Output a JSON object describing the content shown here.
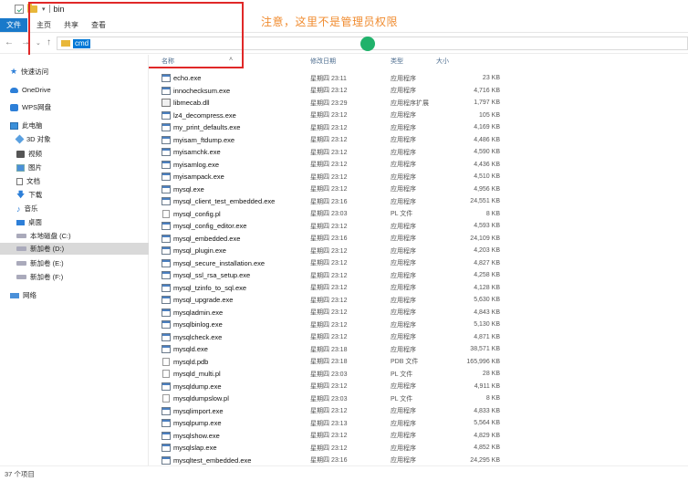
{
  "window": {
    "title": "bin"
  },
  "ribbon": {
    "file": "文件",
    "tabs": [
      "主页",
      "共享",
      "查看"
    ]
  },
  "address": {
    "value": "cmd"
  },
  "annotation": {
    "text": "注意，这里不是管理员权限"
  },
  "columns": {
    "name": "名称",
    "date": "修改日期",
    "type": "类型",
    "size": "大小"
  },
  "sidebar": {
    "items": [
      {
        "label": "快速访问",
        "icon": "star-icon"
      },
      {
        "label": "OneDrive",
        "icon": "cloud-icon"
      },
      {
        "label": "WPS网盘",
        "icon": "wps-cloud-icon"
      },
      {
        "label": "此电脑",
        "icon": "computer-icon"
      },
      {
        "label": "3D 对象",
        "icon": "cube-icon"
      },
      {
        "label": "视频",
        "icon": "video-icon"
      },
      {
        "label": "图片",
        "icon": "picture-icon"
      },
      {
        "label": "文档",
        "icon": "document-icon"
      },
      {
        "label": "下载",
        "icon": "download-arrow-icon"
      },
      {
        "label": "音乐",
        "icon": "music-note-icon"
      },
      {
        "label": "桌面",
        "icon": "desktop-icon"
      },
      {
        "label": "本地磁盘 (C:)",
        "icon": "drive-icon"
      },
      {
        "label": "新加卷 (D:)",
        "icon": "drive-icon",
        "selected": true
      },
      {
        "label": "新加卷 (E:)",
        "icon": "drive-icon"
      },
      {
        "label": "新加卷 (F:)",
        "icon": "drive-icon"
      },
      {
        "label": "网络",
        "icon": "network-icon"
      }
    ]
  },
  "files": [
    {
      "name": "echo.exe",
      "date": "星期四 23:11",
      "type": "应用程序",
      "size": "23 KB",
      "kind": "exe"
    },
    {
      "name": "innochecksum.exe",
      "date": "星期四 23:12",
      "type": "应用程序",
      "size": "4,716 KB",
      "kind": "exe"
    },
    {
      "name": "libmecab.dll",
      "date": "星期四 23:29",
      "type": "应用程序扩展",
      "size": "1,797 KB",
      "kind": "dll"
    },
    {
      "name": "lz4_decompress.exe",
      "date": "星期四 23:12",
      "type": "应用程序",
      "size": "105 KB",
      "kind": "exe"
    },
    {
      "name": "my_print_defaults.exe",
      "date": "星期四 23:12",
      "type": "应用程序",
      "size": "4,169 KB",
      "kind": "exe"
    },
    {
      "name": "myisam_ftdump.exe",
      "date": "星期四 23:12",
      "type": "应用程序",
      "size": "4,486 KB",
      "kind": "exe"
    },
    {
      "name": "myisamchk.exe",
      "date": "星期四 23:12",
      "type": "应用程序",
      "size": "4,590 KB",
      "kind": "exe"
    },
    {
      "name": "myisamlog.exe",
      "date": "星期四 23:12",
      "type": "应用程序",
      "size": "4,436 KB",
      "kind": "exe"
    },
    {
      "name": "myisampack.exe",
      "date": "星期四 23:12",
      "type": "应用程序",
      "size": "4,510 KB",
      "kind": "exe"
    },
    {
      "name": "mysql.exe",
      "date": "星期四 23:12",
      "type": "应用程序",
      "size": "4,956 KB",
      "kind": "exe"
    },
    {
      "name": "mysql_client_test_embedded.exe",
      "date": "星期四 23:16",
      "type": "应用程序",
      "size": "24,551 KB",
      "kind": "exe"
    },
    {
      "name": "mysql_config.pl",
      "date": "星期四 23:03",
      "type": "PL 文件",
      "size": "8 KB",
      "kind": "pl"
    },
    {
      "name": "mysql_config_editor.exe",
      "date": "星期四 23:12",
      "type": "应用程序",
      "size": "4,593 KB",
      "kind": "exe"
    },
    {
      "name": "mysql_embedded.exe",
      "date": "星期四 23:16",
      "type": "应用程序",
      "size": "24,109 KB",
      "kind": "exe"
    },
    {
      "name": "mysql_plugin.exe",
      "date": "星期四 23:12",
      "type": "应用程序",
      "size": "4,203 KB",
      "kind": "exe"
    },
    {
      "name": "mysql_secure_installation.exe",
      "date": "星期四 23:12",
      "type": "应用程序",
      "size": "4,827 KB",
      "kind": "exe"
    },
    {
      "name": "mysql_ssl_rsa_setup.exe",
      "date": "星期四 23:12",
      "type": "应用程序",
      "size": "4,258 KB",
      "kind": "exe"
    },
    {
      "name": "mysql_tzinfo_to_sql.exe",
      "date": "星期四 23:12",
      "type": "应用程序",
      "size": "4,128 KB",
      "kind": "exe"
    },
    {
      "name": "mysql_upgrade.exe",
      "date": "星期四 23:12",
      "type": "应用程序",
      "size": "5,630 KB",
      "kind": "exe"
    },
    {
      "name": "mysqladmin.exe",
      "date": "星期四 23:12",
      "type": "应用程序",
      "size": "4,843 KB",
      "kind": "exe"
    },
    {
      "name": "mysqlbinlog.exe",
      "date": "星期四 23:12",
      "type": "应用程序",
      "size": "5,130 KB",
      "kind": "exe"
    },
    {
      "name": "mysqlcheck.exe",
      "date": "星期四 23:12",
      "type": "应用程序",
      "size": "4,871 KB",
      "kind": "exe"
    },
    {
      "name": "mysqld.exe",
      "date": "星期四 23:18",
      "type": "应用程序",
      "size": "38,571 KB",
      "kind": "exe"
    },
    {
      "name": "mysqld.pdb",
      "date": "星期四 23:18",
      "type": "PDB 文件",
      "size": "165,996 KB",
      "kind": "pdb"
    },
    {
      "name": "mysqld_multi.pl",
      "date": "星期四 23:03",
      "type": "PL 文件",
      "size": "28 KB",
      "kind": "pl"
    },
    {
      "name": "mysqldump.exe",
      "date": "星期四 23:12",
      "type": "应用程序",
      "size": "4,911 KB",
      "kind": "exe"
    },
    {
      "name": "mysqldumpslow.pl",
      "date": "星期四 23:03",
      "type": "PL 文件",
      "size": "8 KB",
      "kind": "pl"
    },
    {
      "name": "mysqlimport.exe",
      "date": "星期四 23:12",
      "type": "应用程序",
      "size": "4,833 KB",
      "kind": "exe"
    },
    {
      "name": "mysqlpump.exe",
      "date": "星期四 23:13",
      "type": "应用程序",
      "size": "5,564 KB",
      "kind": "exe"
    },
    {
      "name": "mysqlshow.exe",
      "date": "星期四 23:12",
      "type": "应用程序",
      "size": "4,829 KB",
      "kind": "exe"
    },
    {
      "name": "mysqlslap.exe",
      "date": "星期四 23:12",
      "type": "应用程序",
      "size": "4,852 KB",
      "kind": "exe"
    },
    {
      "name": "mysqltest_embedded.exe",
      "date": "星期四 23:16",
      "type": "应用程序",
      "size": "24,295 KB",
      "kind": "exe"
    }
  ],
  "status": {
    "count": "37 个项目"
  },
  "colors": {
    "file_tab": "#1979ca",
    "annotation": "#f08c30",
    "redbox": "#e02828",
    "green_dot": "#20b26b"
  }
}
